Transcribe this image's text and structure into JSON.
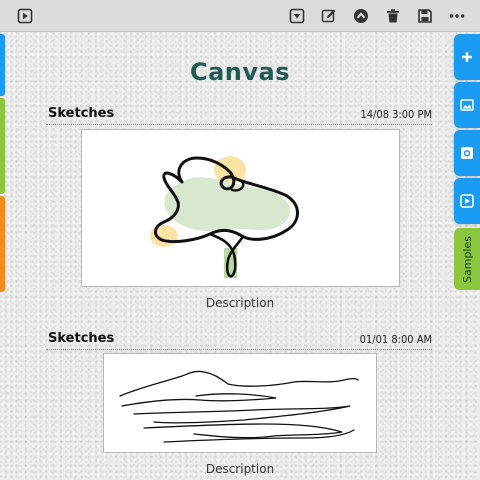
{
  "toolbar": {
    "left_icon": "play-square-icon",
    "right_icons": [
      "dropdown-square-icon",
      "edit-icon",
      "upload-circle-icon",
      "trash-icon",
      "save-icon",
      "more-icon"
    ]
  },
  "title": "Canvas",
  "side_tabs": {
    "icons": [
      "plus-icon",
      "image-icon",
      "camera-icon",
      "video-icon"
    ],
    "samples_label": "Samples"
  },
  "left_tab_colors": [
    "#1a9af0",
    "#8cc63e",
    "#f28c1c"
  ],
  "cards": [
    {
      "title": "Sketches",
      "date": "14/08 3:00 PM",
      "description": "Description",
      "drawing": "flower-sketch"
    },
    {
      "title": "Sketches",
      "date": "01/01 8:00 AM",
      "description": "Description",
      "drawing": "landscape-sketch"
    }
  ]
}
